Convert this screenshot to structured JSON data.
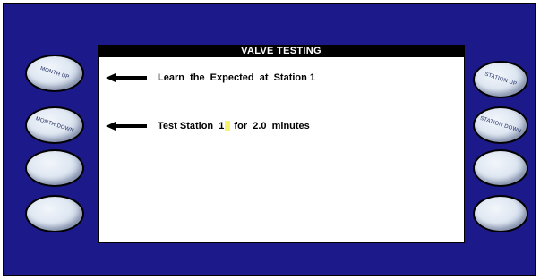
{
  "screen": {
    "title": "VALVE TESTING",
    "lines": [
      {
        "text": "Learn  the  Expected  at  Station 1"
      },
      {
        "text_before": "Test Station  1",
        "text_after": " for  2.0  minutes"
      }
    ]
  },
  "buttons": {
    "left": [
      {
        "label": "MONTH UP"
      },
      {
        "label": "MONTH DOWN"
      },
      {
        "label": ""
      },
      {
        "label": ""
      }
    ],
    "right": [
      {
        "label": "STATION UP"
      },
      {
        "label": "STATION DOWN"
      },
      {
        "label": ""
      },
      {
        "label": ""
      }
    ]
  },
  "colors": {
    "panel": "#1c1a8a",
    "screen": "#ffffff",
    "cursor": "#f7f26a"
  }
}
